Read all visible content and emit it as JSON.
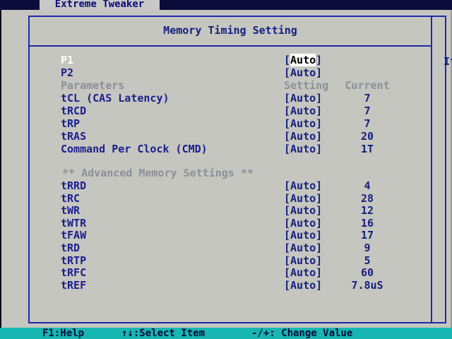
{
  "top_tab": "Extreme Tweaker",
  "panel_title": "Memory Timing Setting",
  "help_text": "It",
  "column_headers": {
    "name": "Parameters",
    "setting": "Setting",
    "current": "Current"
  },
  "rows": [
    {
      "name": "P1",
      "setting": "Auto",
      "current": "",
      "selected": true
    },
    {
      "name": "P2",
      "setting": "Auto",
      "current": ""
    },
    {
      "name": "tCL (CAS Latency)",
      "setting": "Auto",
      "current": "7"
    },
    {
      "name": "tRCD",
      "setting": "Auto",
      "current": "7"
    },
    {
      "name": "tRP",
      "setting": "Auto",
      "current": "7"
    },
    {
      "name": "tRAS",
      "setting": "Auto",
      "current": "20"
    },
    {
      "name": "Command Per Clock (CMD)",
      "setting": "Auto",
      "current": "1T"
    }
  ],
  "advanced_header": "** Advanced Memory Settings **",
  "advanced_rows": [
    {
      "name": "tRRD",
      "setting": "Auto",
      "current": "4"
    },
    {
      "name": "tRC",
      "setting": "Auto",
      "current": "28"
    },
    {
      "name": "tWR",
      "setting": "Auto",
      "current": "12"
    },
    {
      "name": "tWTR",
      "setting": "Auto",
      "current": "16"
    },
    {
      "name": "tFAW",
      "setting": "Auto",
      "current": "17"
    },
    {
      "name": "tRD",
      "setting": "Auto",
      "current": "9"
    },
    {
      "name": "tRTP",
      "setting": "Auto",
      "current": "5"
    },
    {
      "name": "tRFC",
      "setting": "Auto",
      "current": "60"
    },
    {
      "name": "tREF",
      "setting": "Auto",
      "current": "7.8uS"
    }
  ],
  "statusbar": {
    "help": "F1:Help",
    "select": "↑↓:Select Item",
    "change": "-/+: Change Value"
  },
  "colors": {
    "panel_bg": "#c6c6c0",
    "frame_blue": "#1c2aa8",
    "text_blue": "#14207e",
    "dim_gray": "#8b8f98",
    "statusbar_teal": "#17b6b0"
  }
}
